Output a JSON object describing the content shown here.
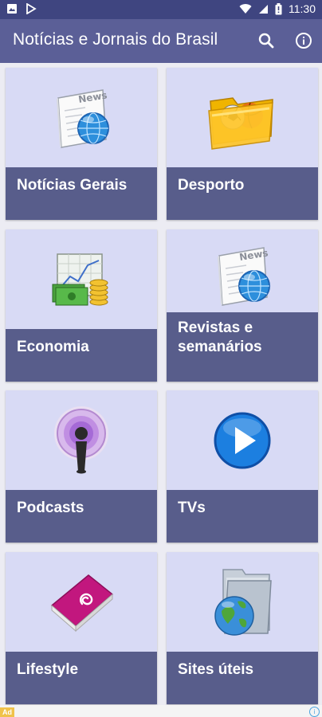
{
  "status_bar": {
    "time": "11:30"
  },
  "app_bar": {
    "title": "Notícias e Jornais do Brasil"
  },
  "tiles": [
    {
      "label": "Notícias Gerais",
      "icon": "news-globe-icon"
    },
    {
      "label": "Desporto",
      "icon": "sports-folder-icon"
    },
    {
      "label": "Economia",
      "icon": "money-chart-icon"
    },
    {
      "label": "Revistas e semanários",
      "icon": "news-globe-icon"
    },
    {
      "label": "Podcasts",
      "icon": "podcast-icon"
    },
    {
      "label": "TVs",
      "icon": "play-icon"
    },
    {
      "label": "Lifestyle",
      "icon": "magazine-icon"
    },
    {
      "label": "Sites úteis",
      "icon": "globe-folder-icon"
    }
  ],
  "ad_bar": {
    "chip": "Ad",
    "info": "i"
  },
  "colors": {
    "status_bar": "#3f4580",
    "app_bar": "#5b5f97",
    "tile_bg": "#d8daf5",
    "tile_label_bg": "#585d8b"
  }
}
